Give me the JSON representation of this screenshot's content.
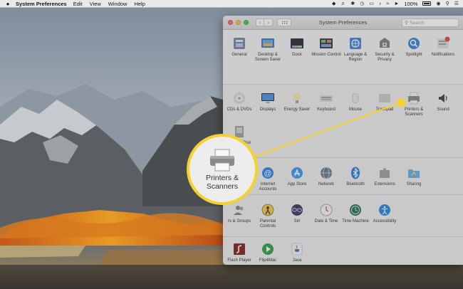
{
  "menubar": {
    "app_name": "System Preferences",
    "menus": [
      "Edit",
      "View",
      "Window",
      "Help"
    ],
    "battery_percent": "100%"
  },
  "window": {
    "title": "System Preferences",
    "search": {
      "placeholder": "Search"
    },
    "sections": [
      {
        "panes": [
          {
            "label": "General",
            "icon": "general-icon"
          },
          {
            "label": "Desktop & Screen Saver",
            "icon": "desktop-screensaver-icon"
          },
          {
            "label": "Dock",
            "icon": "dock-icon"
          },
          {
            "label": "Mission Control",
            "icon": "mission-control-icon"
          },
          {
            "label": "Language & Region",
            "icon": "language-region-icon"
          },
          {
            "label": "Security & Privacy",
            "icon": "security-privacy-icon"
          },
          {
            "label": "Spotlight",
            "icon": "spotlight-icon"
          },
          {
            "label": "Notifications",
            "icon": "notifications-icon"
          }
        ]
      },
      {
        "panes": [
          {
            "label": "CDs & DVDs",
            "icon": "cds-dvds-icon"
          },
          {
            "label": "Displays",
            "icon": "displays-icon"
          },
          {
            "label": "Energy Saver",
            "icon": "energy-saver-icon"
          },
          {
            "label": "Keyboard",
            "icon": "keyboard-icon"
          },
          {
            "label": "Mouse",
            "icon": "mouse-icon"
          },
          {
            "label": "Trackpad",
            "icon": "trackpad-icon"
          },
          {
            "label": "Printers & Scanners",
            "icon": "printers-scanners-icon"
          },
          {
            "label": "Sound",
            "icon": "sound-icon"
          },
          {
            "label": "Startup Disk",
            "icon": "startup-disk-icon"
          }
        ]
      },
      {
        "panes": [
          {
            "label": "Internet Accounts",
            "icon": "internet-accounts-icon"
          },
          {
            "label": "App Store",
            "icon": "app-store-icon"
          },
          {
            "label": "Network",
            "icon": "network-icon"
          },
          {
            "label": "Bluetooth",
            "icon": "bluetooth-icon"
          },
          {
            "label": "Extensions",
            "icon": "extensions-icon"
          },
          {
            "label": "Sharing",
            "icon": "sharing-icon"
          }
        ]
      },
      {
        "panes": [
          {
            "label": "rs & Groups",
            "icon": "users-groups-icon"
          },
          {
            "label": "Parental Controls",
            "icon": "parental-controls-icon"
          },
          {
            "label": "Siri",
            "icon": "siri-icon"
          },
          {
            "label": "Date & Time",
            "icon": "date-time-icon"
          },
          {
            "label": "Time Machine",
            "icon": "time-machine-icon"
          },
          {
            "label": "Accessibility",
            "icon": "accessibility-icon"
          }
        ]
      },
      {
        "panes": [
          {
            "label": "Flash Player",
            "icon": "flash-player-icon"
          },
          {
            "label": "Flip4Mac",
            "icon": "flip4mac-icon"
          },
          {
            "label": "Java",
            "icon": "java-icon"
          }
        ]
      }
    ]
  },
  "callout": {
    "label": "Printers & Scanners",
    "icon": "printer-icon"
  },
  "colors": {
    "callout_accent": "#f3d12e",
    "window_bg": "#ececec",
    "menubar_bg": "#ececec"
  }
}
